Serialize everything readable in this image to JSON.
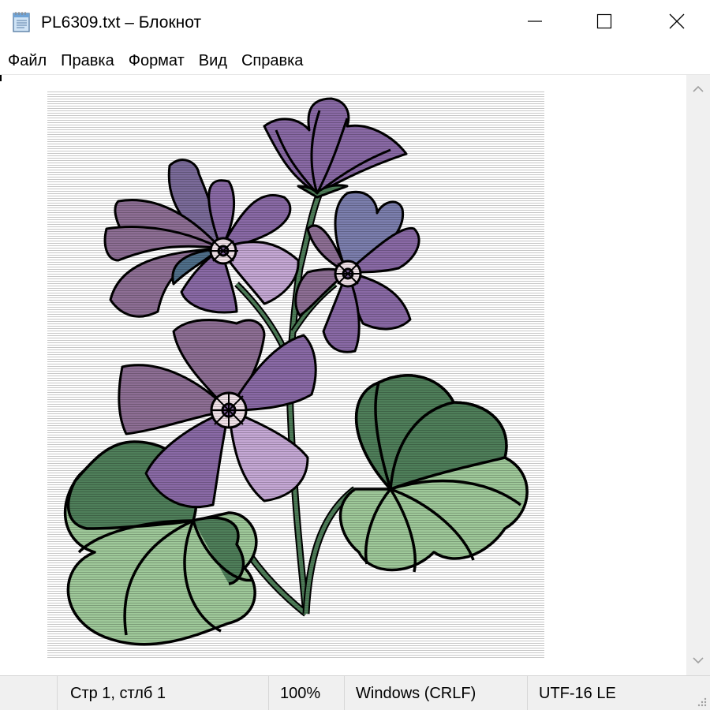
{
  "window": {
    "title": "PL6309.txt – Блокнот",
    "icon": "notepad-icon",
    "controls": {
      "minimize_icon": "minimize-icon",
      "maximize_icon": "maximize-icon",
      "close_icon": "close-icon"
    }
  },
  "menu": {
    "items": [
      {
        "label": "Файл"
      },
      {
        "label": "Правка"
      },
      {
        "label": "Формат"
      },
      {
        "label": "Вид"
      },
      {
        "label": "Справка"
      }
    ]
  },
  "content": {
    "image_description_icon": "flower-illustration-icon"
  },
  "status": {
    "position": "Стр 1, стлб 1",
    "zoom": "100%",
    "line_endings": "Windows (CRLF)",
    "encoding": "UTF-16 LE"
  },
  "colors": {
    "leaf_light": "#9fc99a",
    "leaf_dark": "#4f7f5a",
    "petal_purple": "#8a6aa6",
    "petal_mauve": "#8e6f95",
    "petal_light": "#c6a9d6",
    "petal_blue": "#7c7fae",
    "center": "#f3e4ea",
    "stem": "#4f7f5a",
    "outline": "#000000"
  }
}
